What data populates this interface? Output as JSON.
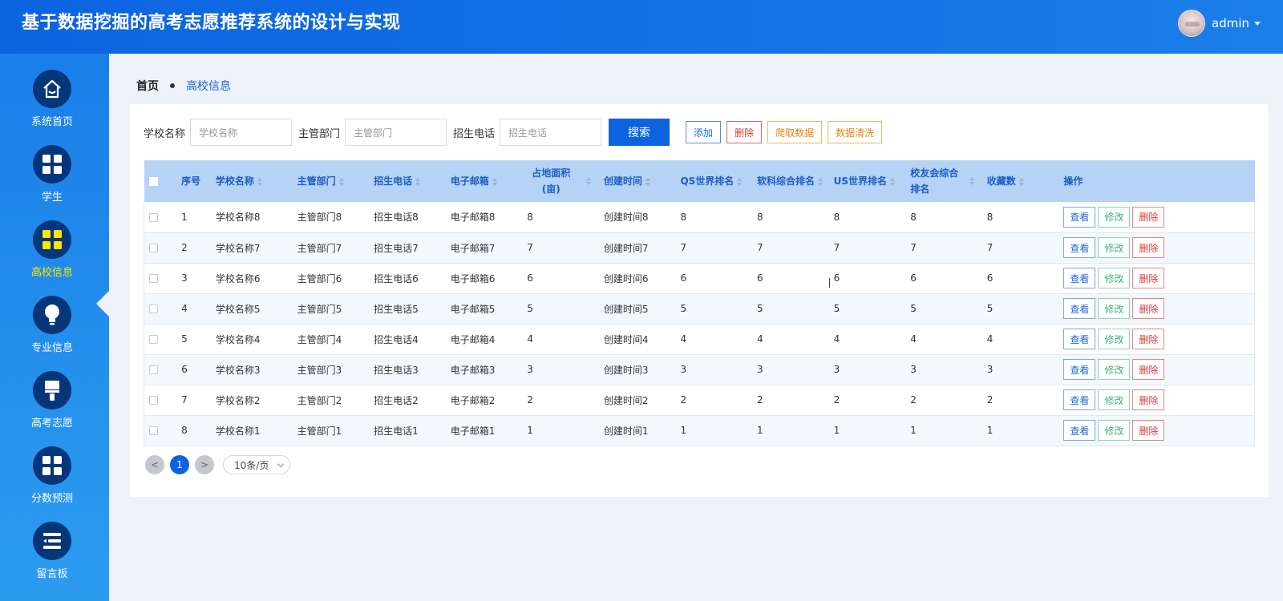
{
  "header": {
    "title": "基于数据挖掘的高考志愿推荐系统的设计与实现",
    "user": "admin"
  },
  "sidebar": {
    "items": [
      {
        "label": "系统首页",
        "icon": "home-icon"
      },
      {
        "label": "学生",
        "icon": "grid-icon"
      },
      {
        "label": "高校信息",
        "icon": "grid-icon",
        "active": true
      },
      {
        "label": "专业信息",
        "icon": "bulb-icon"
      },
      {
        "label": "高考志愿",
        "icon": "brush-icon"
      },
      {
        "label": "分数预测",
        "icon": "grid-icon"
      },
      {
        "label": "留言板",
        "icon": "list-icon"
      }
    ]
  },
  "breadcrumb": {
    "home": "首页",
    "current": "高校信息"
  },
  "search": {
    "school_label": "学校名称",
    "school_placeholder": "学校名称",
    "dept_label": "主管部门",
    "dept_placeholder": "主管部门",
    "phone_label": "招生电话",
    "phone_placeholder": "招生电话",
    "search_btn": "搜索",
    "add_btn": "添加",
    "delete_btn": "删除",
    "crawl_btn": "爬取数据",
    "clean_btn": "数据清洗"
  },
  "table": {
    "headers": [
      "序号",
      "学校名称",
      "主管部门",
      "招生电话",
      "电子邮箱",
      "占地面积(亩)",
      "创建时间",
      "QS世界排名",
      "软科综合排名",
      "US世界排名",
      "校友会综合排名",
      "收藏数",
      "操作"
    ],
    "actions": {
      "view": "查看",
      "edit": "修改",
      "delete": "删除"
    },
    "rows": [
      [
        "1",
        "学校名称8",
        "主管部门8",
        "招生电话8",
        "电子邮箱8",
        "8",
        "创建时间8",
        "8",
        "8",
        "8",
        "8",
        "8"
      ],
      [
        "2",
        "学校名称7",
        "主管部门7",
        "招生电话7",
        "电子邮箱7",
        "7",
        "创建时间7",
        "7",
        "7",
        "7",
        "7",
        "7"
      ],
      [
        "3",
        "学校名称6",
        "主管部门6",
        "招生电话6",
        "电子邮箱6",
        "6",
        "创建时间6",
        "6",
        "6",
        "6",
        "6",
        "6"
      ],
      [
        "4",
        "学校名称5",
        "主管部门5",
        "招生电话5",
        "电子邮箱5",
        "5",
        "创建时间5",
        "5",
        "5",
        "5",
        "5",
        "5"
      ],
      [
        "5",
        "学校名称4",
        "主管部门4",
        "招生电话4",
        "电子邮箱4",
        "4",
        "创建时间4",
        "4",
        "4",
        "4",
        "4",
        "4"
      ],
      [
        "6",
        "学校名称3",
        "主管部门3",
        "招生电话3",
        "电子邮箱3",
        "3",
        "创建时间3",
        "3",
        "3",
        "3",
        "3",
        "3"
      ],
      [
        "7",
        "学校名称2",
        "主管部门2",
        "招生电话2",
        "电子邮箱2",
        "2",
        "创建时间2",
        "2",
        "2",
        "2",
        "2",
        "2"
      ],
      [
        "8",
        "学校名称1",
        "主管部门1",
        "招生电话1",
        "电子邮箱1",
        "1",
        "创建时间1",
        "1",
        "1",
        "1",
        "1",
        "1"
      ]
    ]
  },
  "pagination": {
    "prev": "<",
    "current": "1",
    "next": ">",
    "page_size": "10条/页"
  },
  "colors": {
    "brand": "#0c63e0",
    "sidebar_active_label": "#ffe500",
    "header_row": "#b6d2f5"
  }
}
